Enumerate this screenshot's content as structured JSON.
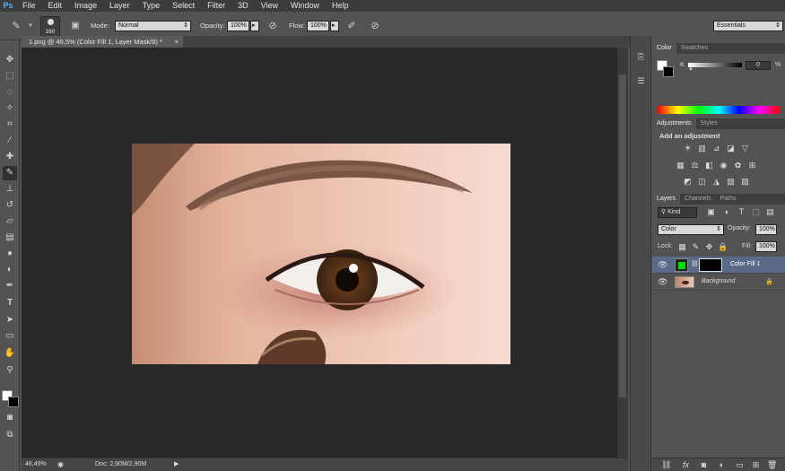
{
  "app": {
    "logo": "Ps"
  },
  "menubar": {
    "items": [
      "File",
      "Edit",
      "Image",
      "Layer",
      "Type",
      "Select",
      "Filter",
      "3D",
      "View",
      "Window",
      "Help"
    ]
  },
  "options": {
    "brush_size": "160",
    "mode_label": "Mode:",
    "mode_value": "Normal",
    "opacity_label": "Opacity:",
    "opacity_value": "100%",
    "flow_label": "Flow:",
    "flow_value": "100%",
    "workspace": "Essentials"
  },
  "document": {
    "tab_title": "1.png @ 46,5% (Color Fill 1, Layer Mask/8) *",
    "close": "×"
  },
  "status": {
    "zoom": "46,49%",
    "doc": "Doc: 2,90M/2,90M"
  },
  "panels": {
    "color": {
      "tabs": [
        "Color",
        "Swatches"
      ],
      "channel": "K",
      "value": "0",
      "unit": "%"
    },
    "adjustments": {
      "tabs": [
        "Adjustments",
        "Styles"
      ],
      "heading": "Add an adjustment"
    },
    "layers": {
      "tabs": [
        "Layers",
        "Channels",
        "Paths"
      ],
      "kind": "Kind",
      "blend": "Color",
      "opacity_label": "Opacity:",
      "opacity_value": "100%",
      "lock_label": "Lock:",
      "fill_label": "Fill:",
      "fill_value": "100%",
      "items": [
        {
          "name": "Color Fill 1",
          "fill_color": "#00dd00"
        },
        {
          "name": "Background"
        }
      ]
    }
  },
  "colors": {
    "foreground": "#ffffff",
    "background": "#000000",
    "accent": "#4fb0ff",
    "layer_selected": "#5a6b8a"
  }
}
